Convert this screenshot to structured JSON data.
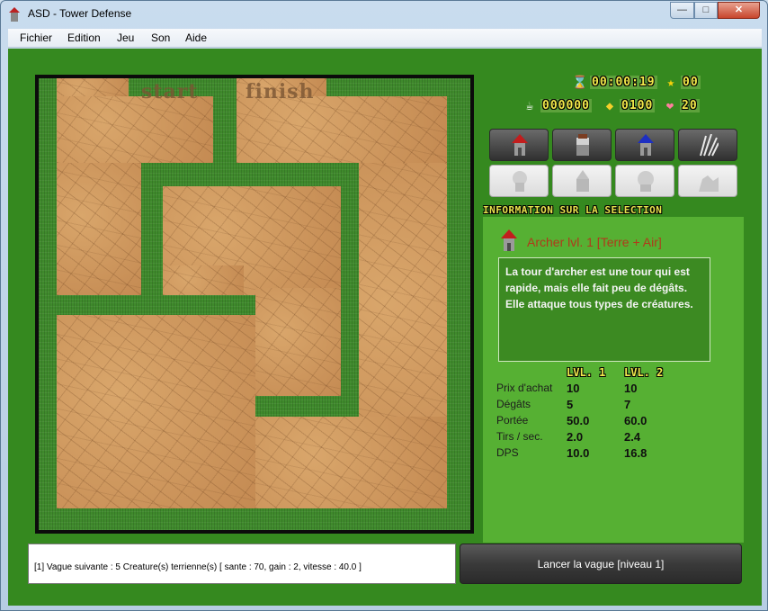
{
  "window": {
    "title": "ASD - Tower Defense",
    "min_glyph": "—",
    "max_glyph": "□",
    "close_glyph": "✕"
  },
  "menu": [
    "Fichier",
    "Edition",
    "Jeu",
    "Son",
    "Aide"
  ],
  "map": {
    "start_label": "start",
    "finish_label": "finish"
  },
  "hud": {
    "timer": "00:00:19",
    "score": "00",
    "coins": "000000",
    "gold": "0100",
    "lives": "20"
  },
  "towers_row1": [
    "archer-tower",
    "cannon-tower",
    "mage-tower",
    "thorn-tower"
  ],
  "towers_row2": [
    "locked-tower-1",
    "locked-tower-2",
    "locked-tower-3",
    "locked-tower-4"
  ],
  "info": {
    "header": "INFORMATION SUR LA SELECTION",
    "name": "Archer lvl. 1 [Terre + Air]",
    "description": "La tour d'archer est une tour qui est rapide, mais elle fait peu de dégâts. Elle attaque tous types de créatures.",
    "level_headers": [
      "LVL. 1",
      "LVL. 2"
    ],
    "stats": [
      {
        "label": "Prix d'achat",
        "lvl1": "10",
        "lvl2": "10"
      },
      {
        "label": "Dégâts",
        "lvl1": "5",
        "lvl2": "7"
      },
      {
        "label": "Portée",
        "lvl1": "50.0",
        "lvl2": "60.0"
      },
      {
        "label": "Tirs / sec.",
        "lvl1": "2.0",
        "lvl2": "2.4"
      },
      {
        "label": "DPS",
        "lvl1": "10.0",
        "lvl2": "16.8"
      }
    ]
  },
  "wave": {
    "next_text": "[1] Vague suivante : 5 Creature(s) terrienne(s) [ sante : 70, gain : 2, vitesse : 40.0 ]"
  },
  "launch_button": "Lancer la vague [niveau 1]",
  "colors": {
    "background": "#35891f",
    "panel": "#56b033",
    "accent_text": "#f2e94a",
    "selection_name": "#b03a1b"
  }
}
